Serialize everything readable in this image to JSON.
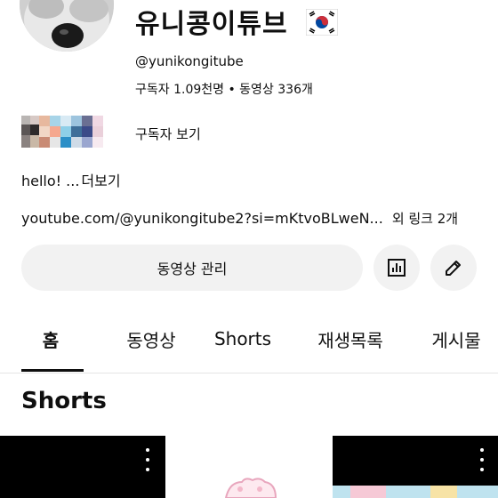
{
  "channel": {
    "name": "유니콩이튜브",
    "handle": "@yunikongitube",
    "stats": "구독자 1.09천명 • 동영상 336개",
    "subscribers_label": "구독자 보기",
    "description": "hello! ...",
    "description_more": "더보기",
    "link": "youtube.com/@yunikongitube2?si=mKtvoBLweN...",
    "link_more": "외 링크 2개"
  },
  "actions": {
    "manage_videos": "동영상 관리",
    "stats_icon": "bar-chart-icon",
    "edit_icon": "pencil-icon"
  },
  "tabs": [
    {
      "label": "홈",
      "active": true
    },
    {
      "label": "동영상",
      "active": false
    },
    {
      "label": "Shorts",
      "active": false
    },
    {
      "label": "재생목록",
      "active": false
    },
    {
      "label": "게시물",
      "active": false
    }
  ],
  "section": {
    "title": "Shorts"
  },
  "colors": {
    "text": "#0f0f0f",
    "button_bg": "#f2f2f2",
    "flag_red": "#cd2e3a",
    "flag_blue": "#0047a0"
  }
}
